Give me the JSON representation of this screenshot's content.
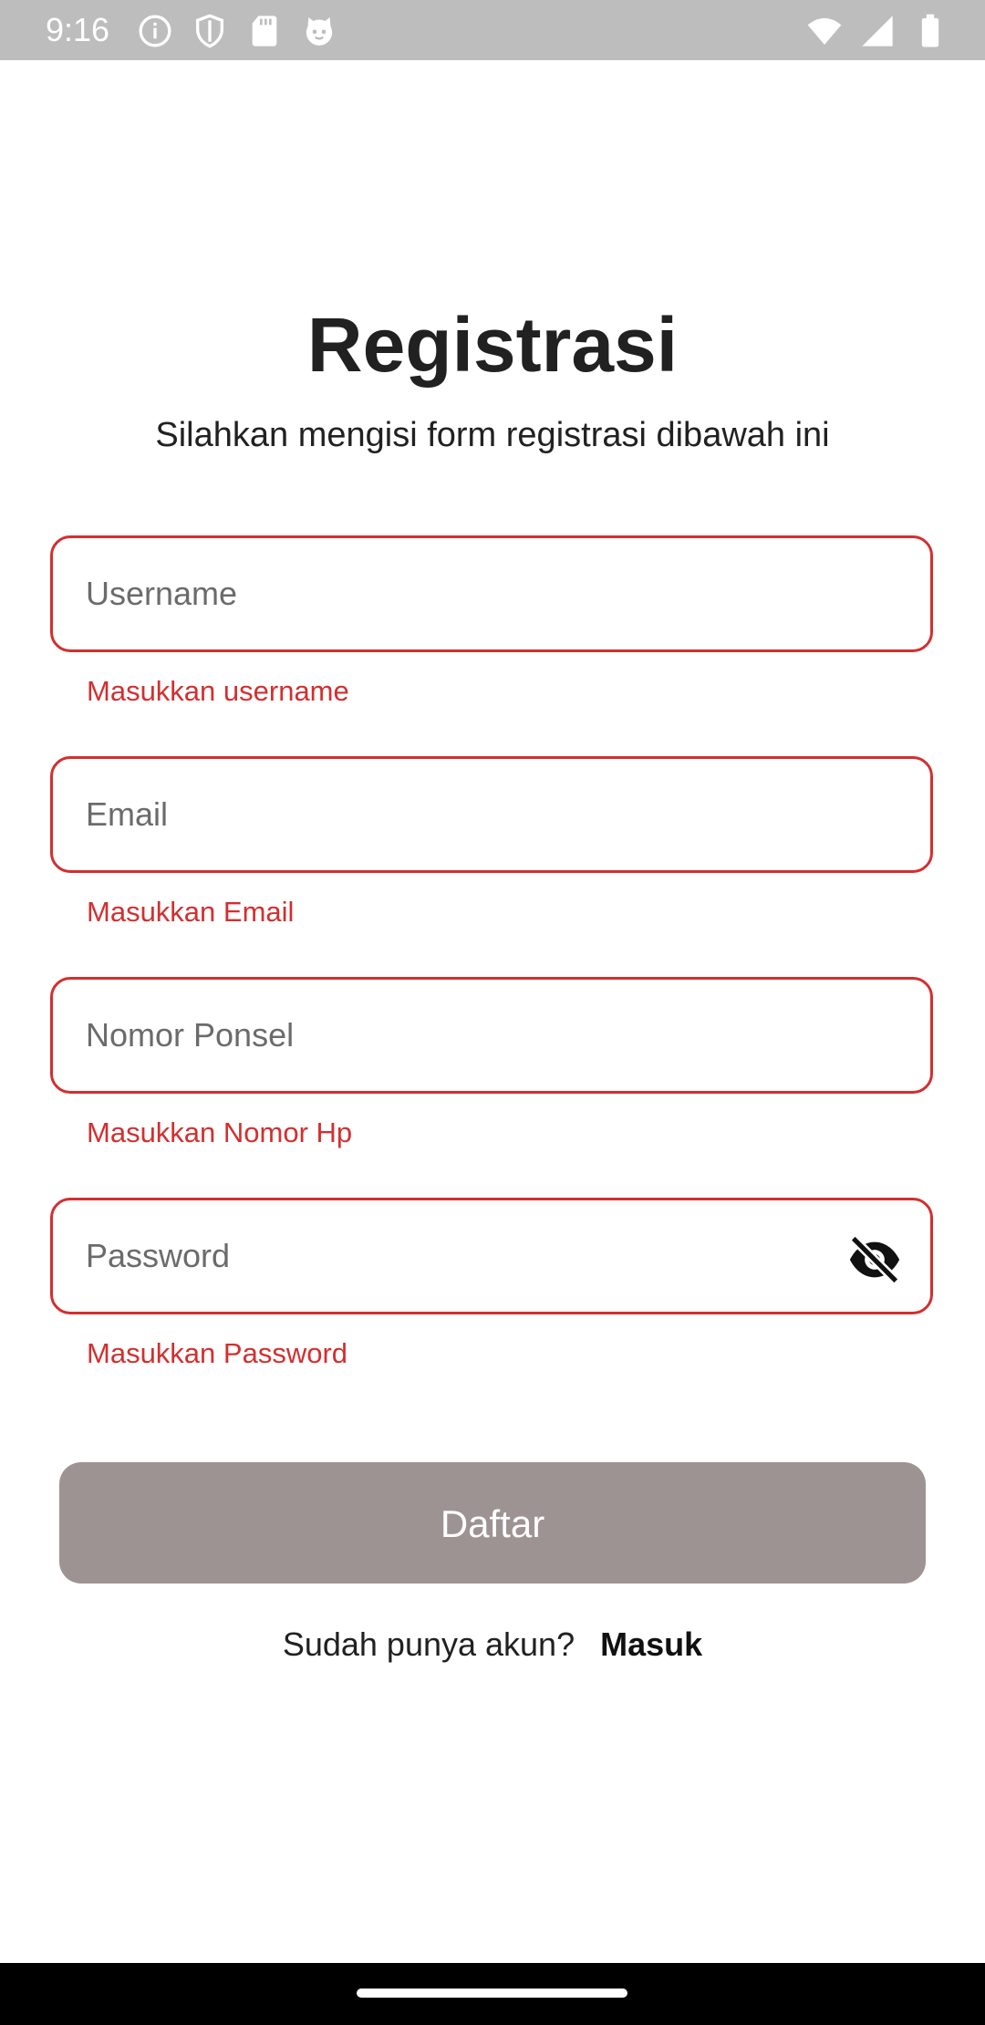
{
  "status_bar": {
    "time": "9:16",
    "left_icons": [
      "info-icon",
      "shield-icon",
      "sd-card-icon",
      "cat-face-icon"
    ],
    "right_icons": [
      "wifi-icon",
      "signal-icon",
      "battery-icon"
    ]
  },
  "header": {
    "title": "Registrasi",
    "subtitle": "Silahkan mengisi form registrasi dibawah ini"
  },
  "form": {
    "username": {
      "placeholder": "Username",
      "value": "",
      "error": "Masukkan username"
    },
    "email": {
      "placeholder": "Email",
      "value": "",
      "error": "Masukkan Email"
    },
    "phone": {
      "placeholder": "Nomor Ponsel",
      "value": "",
      "error": "Masukkan Nomor Hp"
    },
    "password": {
      "placeholder": "Password",
      "value": "",
      "error": "Masukkan Password",
      "toggle_icon": "eye-off-icon"
    }
  },
  "submit": {
    "label": "Daftar",
    "color": "#9e9393"
  },
  "login_prompt": {
    "text": "Sudah punya akun?",
    "link": "Masuk"
  },
  "colors": {
    "error": "#d32f2f",
    "status_bar": "#bdbdbd",
    "nav_bar": "#000000"
  }
}
